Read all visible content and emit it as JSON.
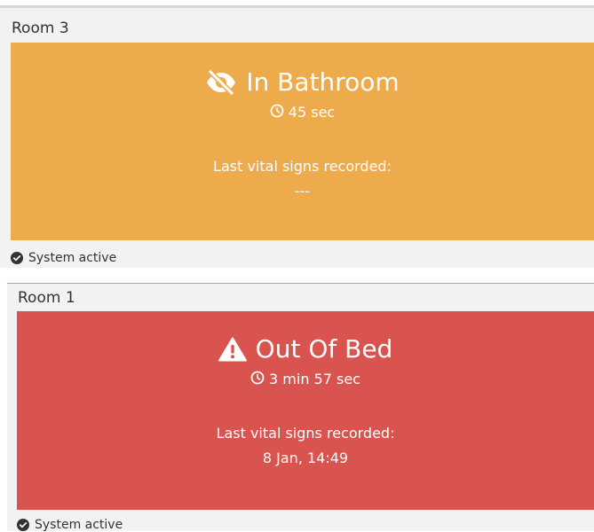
{
  "colors": {
    "alert_warning": "#eeab4b",
    "alert_danger": "#d9534f",
    "card_background": "#f2f2f2",
    "card2_top_border": "#5bc0de"
  },
  "rooms": [
    {
      "title": "Room 3",
      "status": "In Bathroom",
      "status_icon": "eye-slash-icon",
      "timer_icon": "clock-icon",
      "duration": "45 sec",
      "vitals_label": "Last vital signs recorded:",
      "vitals_value": "---",
      "footer_icon": "check-circle-icon",
      "footer_text": "System active"
    },
    {
      "title": "Room 1",
      "status": "Out Of Bed",
      "status_icon": "warning-triangle-icon",
      "timer_icon": "clock-icon",
      "duration": "3 min 57 sec",
      "vitals_label": "Last vital signs recorded:",
      "vitals_value": "8 Jan, 14:49",
      "footer_icon": "check-circle-icon",
      "footer_text": "System active"
    }
  ]
}
